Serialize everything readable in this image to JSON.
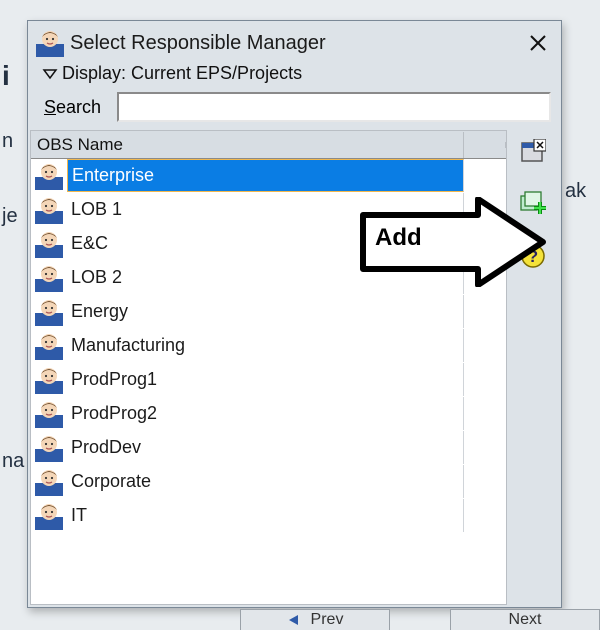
{
  "dialog": {
    "title": "Select Responsible Manager",
    "display_label": "Display: Current EPS/Projects",
    "search_label": "Search",
    "search_value": "",
    "column_header": "OBS Name",
    "items": [
      {
        "label": "Enterprise",
        "selected": true
      },
      {
        "label": "LOB 1",
        "selected": false
      },
      {
        "label": "E&C",
        "selected": false
      },
      {
        "label": "LOB 2",
        "selected": false
      },
      {
        "label": "Energy",
        "selected": false
      },
      {
        "label": "Manufacturing",
        "selected": false
      },
      {
        "label": "ProdProg1",
        "selected": false
      },
      {
        "label": "ProdProg2",
        "selected": false
      },
      {
        "label": "ProdDev",
        "selected": false
      },
      {
        "label": "Corporate",
        "selected": false
      },
      {
        "label": "IT",
        "selected": false
      }
    ],
    "side_buttons": {
      "close_window": "close-window",
      "add": "add",
      "help": "help"
    }
  },
  "annotation": {
    "label": "Add"
  },
  "bg": {
    "prev": "Prev",
    "next": "Next"
  }
}
